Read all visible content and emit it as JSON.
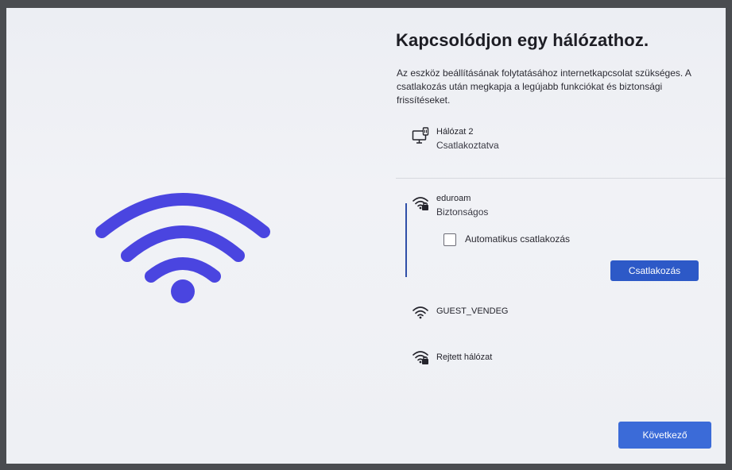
{
  "colors": {
    "accent": "#2d59c7",
    "wifi_illustration": "#4a45e0"
  },
  "illustration": {
    "icon": "wifi-illustration-icon"
  },
  "page": {
    "title": "Kapcsolódjon egy hálózathoz.",
    "description": "Az eszköz beállításának folytatásához internetkapcsolat szükséges. A csatlakozás után megkapja a legújabb funkciókat és biztonsági frissítéseket."
  },
  "networks": [
    {
      "name": "Hálózat 2",
      "status": "Csatlakoztatva",
      "icon": "ethernet-monitor-icon"
    },
    {
      "name": "eduroam",
      "status": "Biztonságos",
      "icon": "wifi-secured-icon",
      "selected": true
    },
    {
      "name": "GUEST_VENDEG",
      "icon": "wifi-icon"
    },
    {
      "name": "Rejtett hálózat",
      "icon": "wifi-secured-icon"
    }
  ],
  "auto_connect": {
    "label": "Automatikus csatlakozás",
    "checked": false
  },
  "buttons": {
    "connect": "Csatlakozás",
    "next": "Következő"
  }
}
